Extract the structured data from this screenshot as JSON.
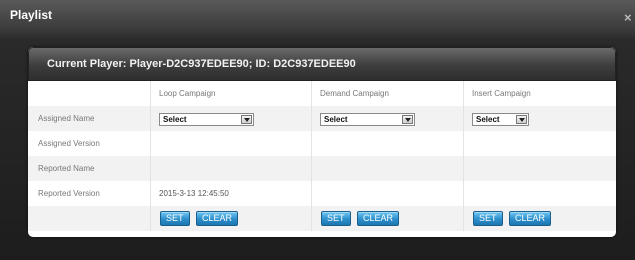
{
  "window": {
    "title": "Playlist",
    "close_glyph": "×"
  },
  "panel": {
    "header": "Current Player: Player-D2C937EDEE90;  ID: D2C937EDEE90"
  },
  "columns": [
    "Loop Campaign",
    "Demand Campaign",
    "Insert Campaign"
  ],
  "rows": {
    "assigned_name": "Assigned Name",
    "assigned_version": "Assigned Version",
    "reported_name": "Reported Name",
    "reported_version": "Reported Version"
  },
  "selects": {
    "loop": "Select",
    "demand": "Select",
    "insert": "Select"
  },
  "reported_version_values": {
    "loop": "2015-3-13 12:45:50",
    "demand": "",
    "insert": ""
  },
  "buttons": {
    "set": "SET",
    "clear": "CLEAR"
  },
  "colors": {
    "button": "#2c8fcc",
    "header": "#3d3d3d"
  }
}
